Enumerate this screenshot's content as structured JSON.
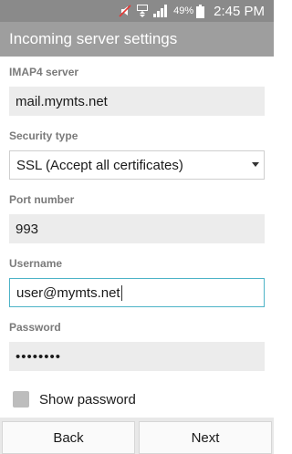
{
  "status_bar": {
    "battery_percent": "49%",
    "time": "2:45 PM",
    "icons": [
      "mute-icon",
      "lte-icon",
      "signal-icon",
      "battery-icon"
    ]
  },
  "app_bar": {
    "title": "Incoming server settings"
  },
  "form": {
    "imap_server": {
      "label": "IMAP4 server",
      "value": "mail.mymts.net"
    },
    "security_type": {
      "label": "Security type",
      "value": "SSL (Accept all certificates)"
    },
    "port": {
      "label": "Port number",
      "value": "993"
    },
    "username": {
      "label": "Username",
      "value": "user@mymts.net"
    },
    "password": {
      "label": "Password",
      "value": "••••••••"
    },
    "show_password": {
      "label": "Show password",
      "checked": false
    }
  },
  "buttons": {
    "back": "Back",
    "next": "Next"
  }
}
